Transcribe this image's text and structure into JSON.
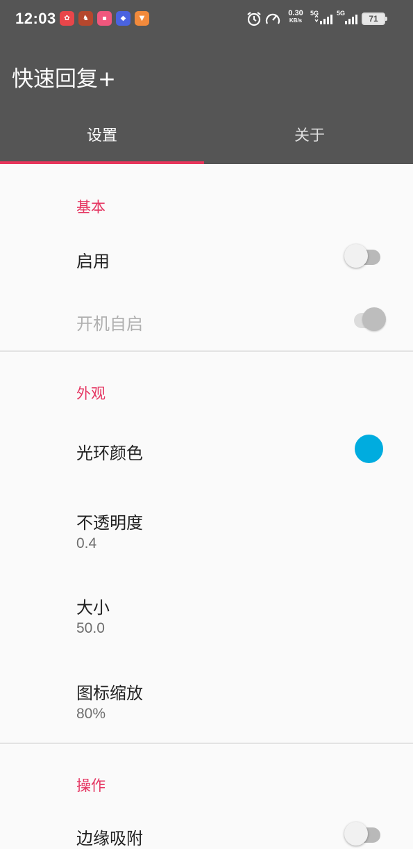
{
  "status_bar": {
    "time": "12:03",
    "net_speed_value": "0.30",
    "net_speed_unit": "KB/s",
    "sim1_label": "5G",
    "sim2_label": "5G",
    "battery": "71",
    "app_icons": [
      "notification-app-1-icon",
      "notification-app-2-icon",
      "notification-app-3-icon",
      "notification-app-4-icon",
      "notification-app-5-icon"
    ]
  },
  "app_bar": {
    "title": "快速回复+",
    "tabs": [
      {
        "label": "设置",
        "active": true
      },
      {
        "label": "关于",
        "active": false
      }
    ]
  },
  "sections": {
    "basic": {
      "header": "基本",
      "enable": {
        "title": "启用",
        "checked": false,
        "enabled": true
      },
      "autostart": {
        "title": "开机自启",
        "checked": true,
        "enabled": false
      }
    },
    "appearance": {
      "header": "外观",
      "halo_color": {
        "title": "光环颜色",
        "color": "#00acdf"
      },
      "opacity": {
        "title": "不透明度",
        "summary": "0.4"
      },
      "size": {
        "title": "大小",
        "summary": "50.0"
      },
      "icon_scale": {
        "title": "图标缩放",
        "summary": "80%"
      }
    },
    "operation": {
      "header": "操作",
      "edge_snap": {
        "title": "边缘吸附",
        "checked": false,
        "enabled": true
      }
    }
  },
  "colors": {
    "app_bar": "#555555",
    "accent": "#e53662",
    "background": "#fafafa"
  }
}
